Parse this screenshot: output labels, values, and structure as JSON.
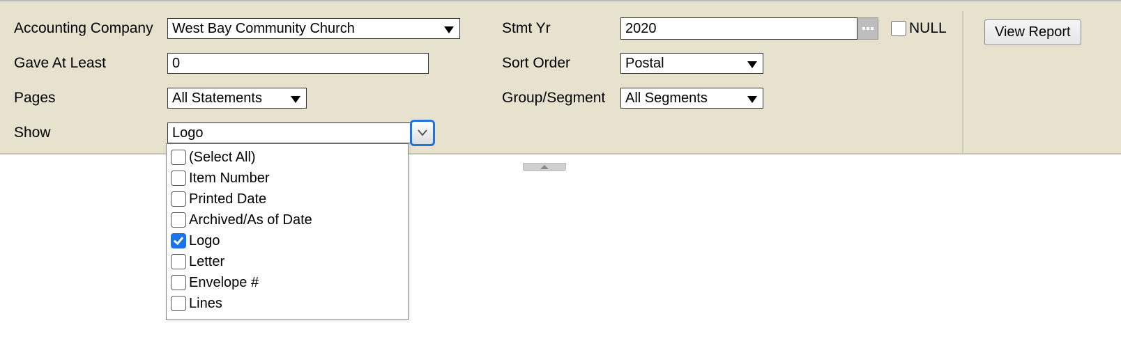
{
  "params": {
    "accounting_company": {
      "label": "Accounting Company",
      "value": "West Bay Community Church"
    },
    "gave_at_least": {
      "label": "Gave At Least",
      "value": "0"
    },
    "pages": {
      "label": "Pages",
      "value": "All Statements"
    },
    "show": {
      "label": "Show",
      "summary": "Logo",
      "options": [
        {
          "label": "(Select All)",
          "checked": false
        },
        {
          "label": "Item Number",
          "checked": false
        },
        {
          "label": "Printed Date",
          "checked": false
        },
        {
          "label": "Archived/As of Date",
          "checked": false
        },
        {
          "label": "Logo",
          "checked": true
        },
        {
          "label": "Letter",
          "checked": false
        },
        {
          "label": "Envelope #",
          "checked": false
        },
        {
          "label": "Lines",
          "checked": false
        }
      ]
    },
    "stmt_yr": {
      "label": "Stmt Yr",
      "value": "2020",
      "null_label": "NULL"
    },
    "sort_order": {
      "label": "Sort Order",
      "value": "Postal"
    },
    "group_segment": {
      "label": "Group/Segment",
      "value": "All Segments"
    }
  },
  "actions": {
    "view_report": "View Report"
  }
}
